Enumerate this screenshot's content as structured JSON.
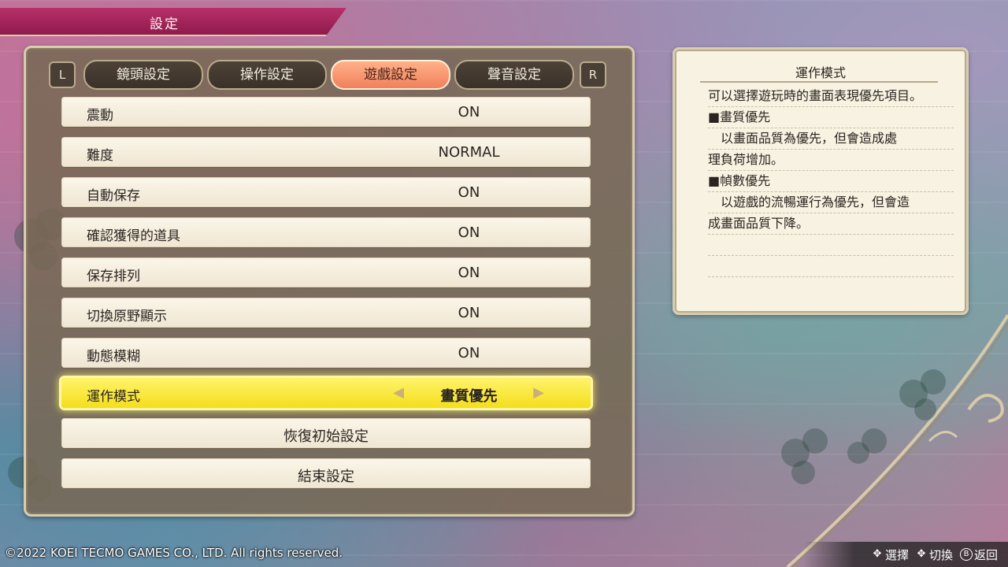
{
  "header": {
    "title": "設定"
  },
  "tabs": {
    "left_shoulder": "L",
    "right_shoulder": "R",
    "items": [
      "鏡頭設定",
      "操作設定",
      "遊戲設定",
      "聲音設定"
    ],
    "active_index": 2
  },
  "settings": [
    {
      "label": "震動",
      "value": "ON"
    },
    {
      "label": "難度",
      "value": "NORMAL"
    },
    {
      "label": "自動保存",
      "value": "ON"
    },
    {
      "label": "確認獲得的道具",
      "value": "ON"
    },
    {
      "label": "保存排列",
      "value": "ON"
    },
    {
      "label": "切換原野顯示",
      "value": "ON"
    },
    {
      "label": "動態模糊",
      "value": "ON"
    },
    {
      "label": "運作模式",
      "value": "畫質優先",
      "selected": true
    }
  ],
  "actions": {
    "reset": "恢復初始設定",
    "exit": "結束設定"
  },
  "info": {
    "title": "運作模式",
    "lines": [
      "可以選擇遊玩時的畫面表現優先項目。",
      "■畫質優先",
      "　以畫面品質為優先，但會造成處",
      "理負荷增加。",
      "■幀數優先",
      "　以遊戲的流暢運行為優先，但會造",
      "成畫面品質下降。",
      "",
      ""
    ]
  },
  "footer": {
    "copyright": "©2022 KOEI TECMO GAMES CO., LTD. All rights reserved.",
    "select_label": "選擇",
    "switch_label": "切換",
    "back_label": "返回",
    "back_button": "B"
  },
  "colors": {
    "accent_banner": "#8e1a4d",
    "active_tab": "#f0805a",
    "selected_row": "#f4de1c"
  },
  "icons": {
    "select": "dpad-icon",
    "switch": "dpad-horizontal-icon",
    "back": "b-button-icon",
    "left": "arrow-left-icon",
    "right": "arrow-right-icon"
  }
}
